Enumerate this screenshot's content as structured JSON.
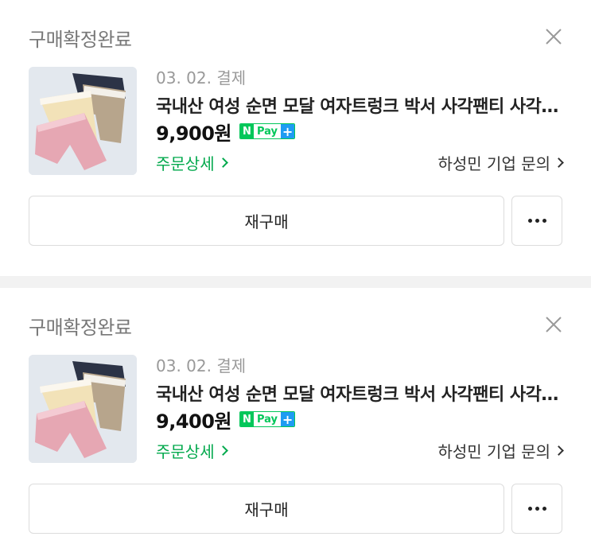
{
  "orders": [
    {
      "status": "구매확정완료",
      "date": "03. 02. 결제",
      "title": "국내산 여성 순면 모달 여자트렁크 박서 사각팬티 사각팬티",
      "price": "9,900원",
      "npay": {
        "n": "N",
        "pay": "Pay",
        "plus": "+"
      },
      "detail_label": "주문상세",
      "inquiry_label": "하성민 기업 문의",
      "rebuy_label": "재구매",
      "thumb_icon": "product-photo-underwear"
    },
    {
      "status": "구매확정완료",
      "date": "03. 02. 결제",
      "title": "국내산 여성 순면 모달 여자트렁크 박서 사각팬티 사각팬티",
      "price": "9,400원",
      "npay": {
        "n": "N",
        "pay": "Pay",
        "plus": "+"
      },
      "detail_label": "주문상세",
      "inquiry_label": "하성민 기업 문의",
      "rebuy_label": "재구매",
      "thumb_icon": "product-photo-underwear"
    }
  ],
  "colors": {
    "accent_green": "#03c75a",
    "detail_green": "#03a94d",
    "npay_plus_blue": "#1e9cf2",
    "divider": "#f2f2f2"
  }
}
